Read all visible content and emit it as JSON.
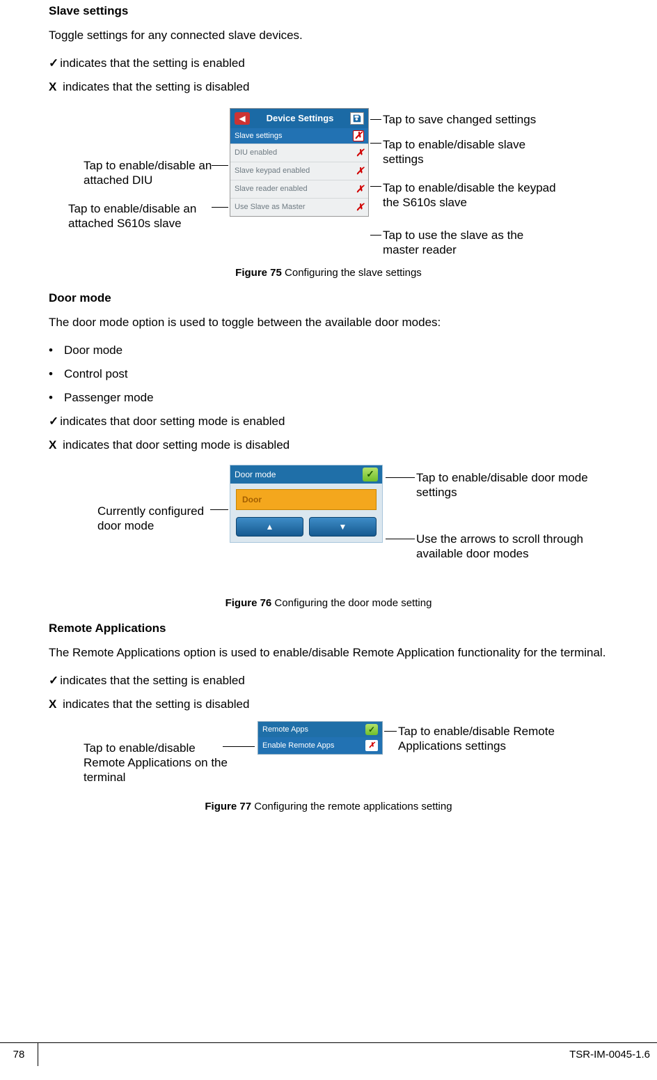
{
  "page_number": "78",
  "doc_id": "TSR-IM-0045-1.6",
  "slave": {
    "heading": "Slave settings",
    "intro": "Toggle settings for any connected slave devices.",
    "check_line": "indicates that the setting is enabled",
    "x_line": " indicates that the setting is disabled",
    "panel": {
      "title": "Device Settings",
      "slave_settings": "Slave settings",
      "rows": [
        "DIU enabled",
        "Slave keypad enabled",
        "Slave reader enabled",
        "Use Slave as Master"
      ]
    },
    "callouts": {
      "save": "Tap to save changed settings",
      "slave_toggle": "Tap to enable/disable slave settings",
      "diu": "Tap to enable/disable an attached DIU",
      "s610": "Tap to enable/disable an attached S610s slave",
      "keypad": "Tap to enable/disable the keypad the S610s slave",
      "master": "Tap to use the slave as the master reader"
    },
    "fig_caption_bold": "Figure 75",
    "fig_caption": " Configuring the slave settings"
  },
  "door": {
    "heading": "Door mode",
    "intro": "The door mode option is used to toggle between the available door modes:",
    "bullets": [
      "Door mode",
      "Control post",
      "Passenger mode"
    ],
    "check_line": "indicates that door setting mode is enabled",
    "x_line": " indicates that door setting mode is disabled",
    "panel": {
      "title": "Door mode",
      "current": "Door"
    },
    "callouts": {
      "toggle": "Tap to enable/disable door mode settings",
      "current": "Currently configured door mode",
      "arrows": "Use the arrows to scroll through available door modes"
    },
    "fig_caption_bold": "Figure 76",
    "fig_caption": " Configuring the door mode setting"
  },
  "remote": {
    "heading": "Remote Applications",
    "intro": "The Remote Applications option is used to enable/disable Remote Application functionality for the terminal.",
    "check_line": "indicates that the setting is enabled",
    "x_line": " indicates that the setting is disabled",
    "panel": {
      "title": "Remote Apps",
      "row": "Enable Remote Apps"
    },
    "callouts": {
      "toggle": "Tap to enable/disable Remote Applications settings",
      "terminal": "Tap to enable/disable Remote Applications on the terminal"
    },
    "fig_caption_bold": "Figure 77",
    "fig_caption": " Configuring the remote applications setting"
  }
}
